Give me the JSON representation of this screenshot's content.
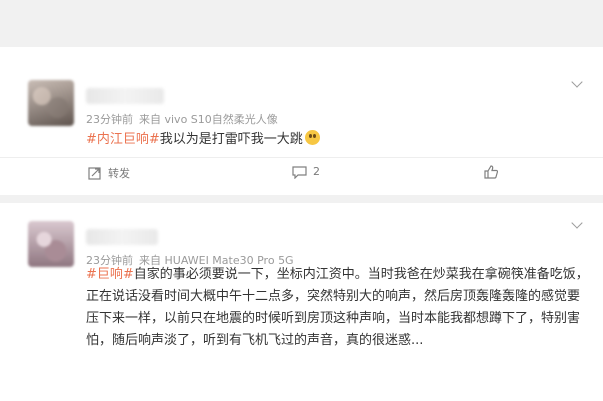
{
  "posts": [
    {
      "meta": {
        "time": "23分钟前",
        "source": "来自 vivo S10自然柔光人像"
      },
      "content": {
        "tag": "#内江巨响#",
        "text": "我以为是打雷吓我一大跳"
      },
      "actions": {
        "repost_label": "转发",
        "comment_count": "2"
      }
    },
    {
      "meta": {
        "time": "23分钟前",
        "source": "来自 HUAWEI Mate30 Pro 5G"
      },
      "content": {
        "tag": "#巨响#",
        "line1": "自家的事必须要说一下，坐标内江资中。当时我爸在炒菜我在拿碗筷准备吃饭，",
        "line2": "正在说话没看时间大概中午十二点多，突然特别大的响声，然后房顶轰隆轰隆的感觉要",
        "line3": "压下来一样，以前只在地震的时候听到房顶这种声响，当时本能我都想蹲下了，特别害",
        "line4": "怕，随后响声淡了，听到有飞机飞过的声音，真的很迷惑..."
      }
    }
  ],
  "icons": [
    "chevron-down-icon",
    "repost-icon",
    "comment-icon",
    "like-icon",
    "emoji-icon"
  ],
  "colors": {
    "tag": "#eb7350",
    "meta": "#9a9a9a",
    "text": "#333333",
    "background": "#f1f1f1"
  }
}
